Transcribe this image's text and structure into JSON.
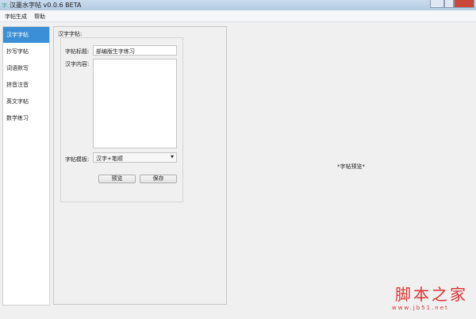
{
  "window": {
    "title": "汉墨水字帖 v0.0.6 BETA"
  },
  "menu": [
    "字帖生成",
    "帮助"
  ],
  "sidebar": {
    "items": [
      {
        "label": "汉字字帖",
        "selected": true
      },
      {
        "label": "抄写字帖"
      },
      {
        "label": "词语默写"
      },
      {
        "label": "拼音注音"
      },
      {
        "label": "英文字帖"
      },
      {
        "label": "数学练习"
      }
    ]
  },
  "form": {
    "section_title": "汉字字帖:",
    "title_label": "字帖标题:",
    "title_value": "部编版生字练习",
    "content_label": "汉字内容:",
    "content_value": "",
    "template_label": "字帖模板:",
    "template_value": "汉字+笔顺",
    "preview_button": "预览",
    "save_button": "保存"
  },
  "preview": {
    "placeholder": "*字帖预览*"
  },
  "watermark": {
    "text": "脚本之家",
    "url": "www.jb51.net"
  },
  "colors": {
    "accent": "#3b8fd6",
    "close": "#c9483a"
  }
}
